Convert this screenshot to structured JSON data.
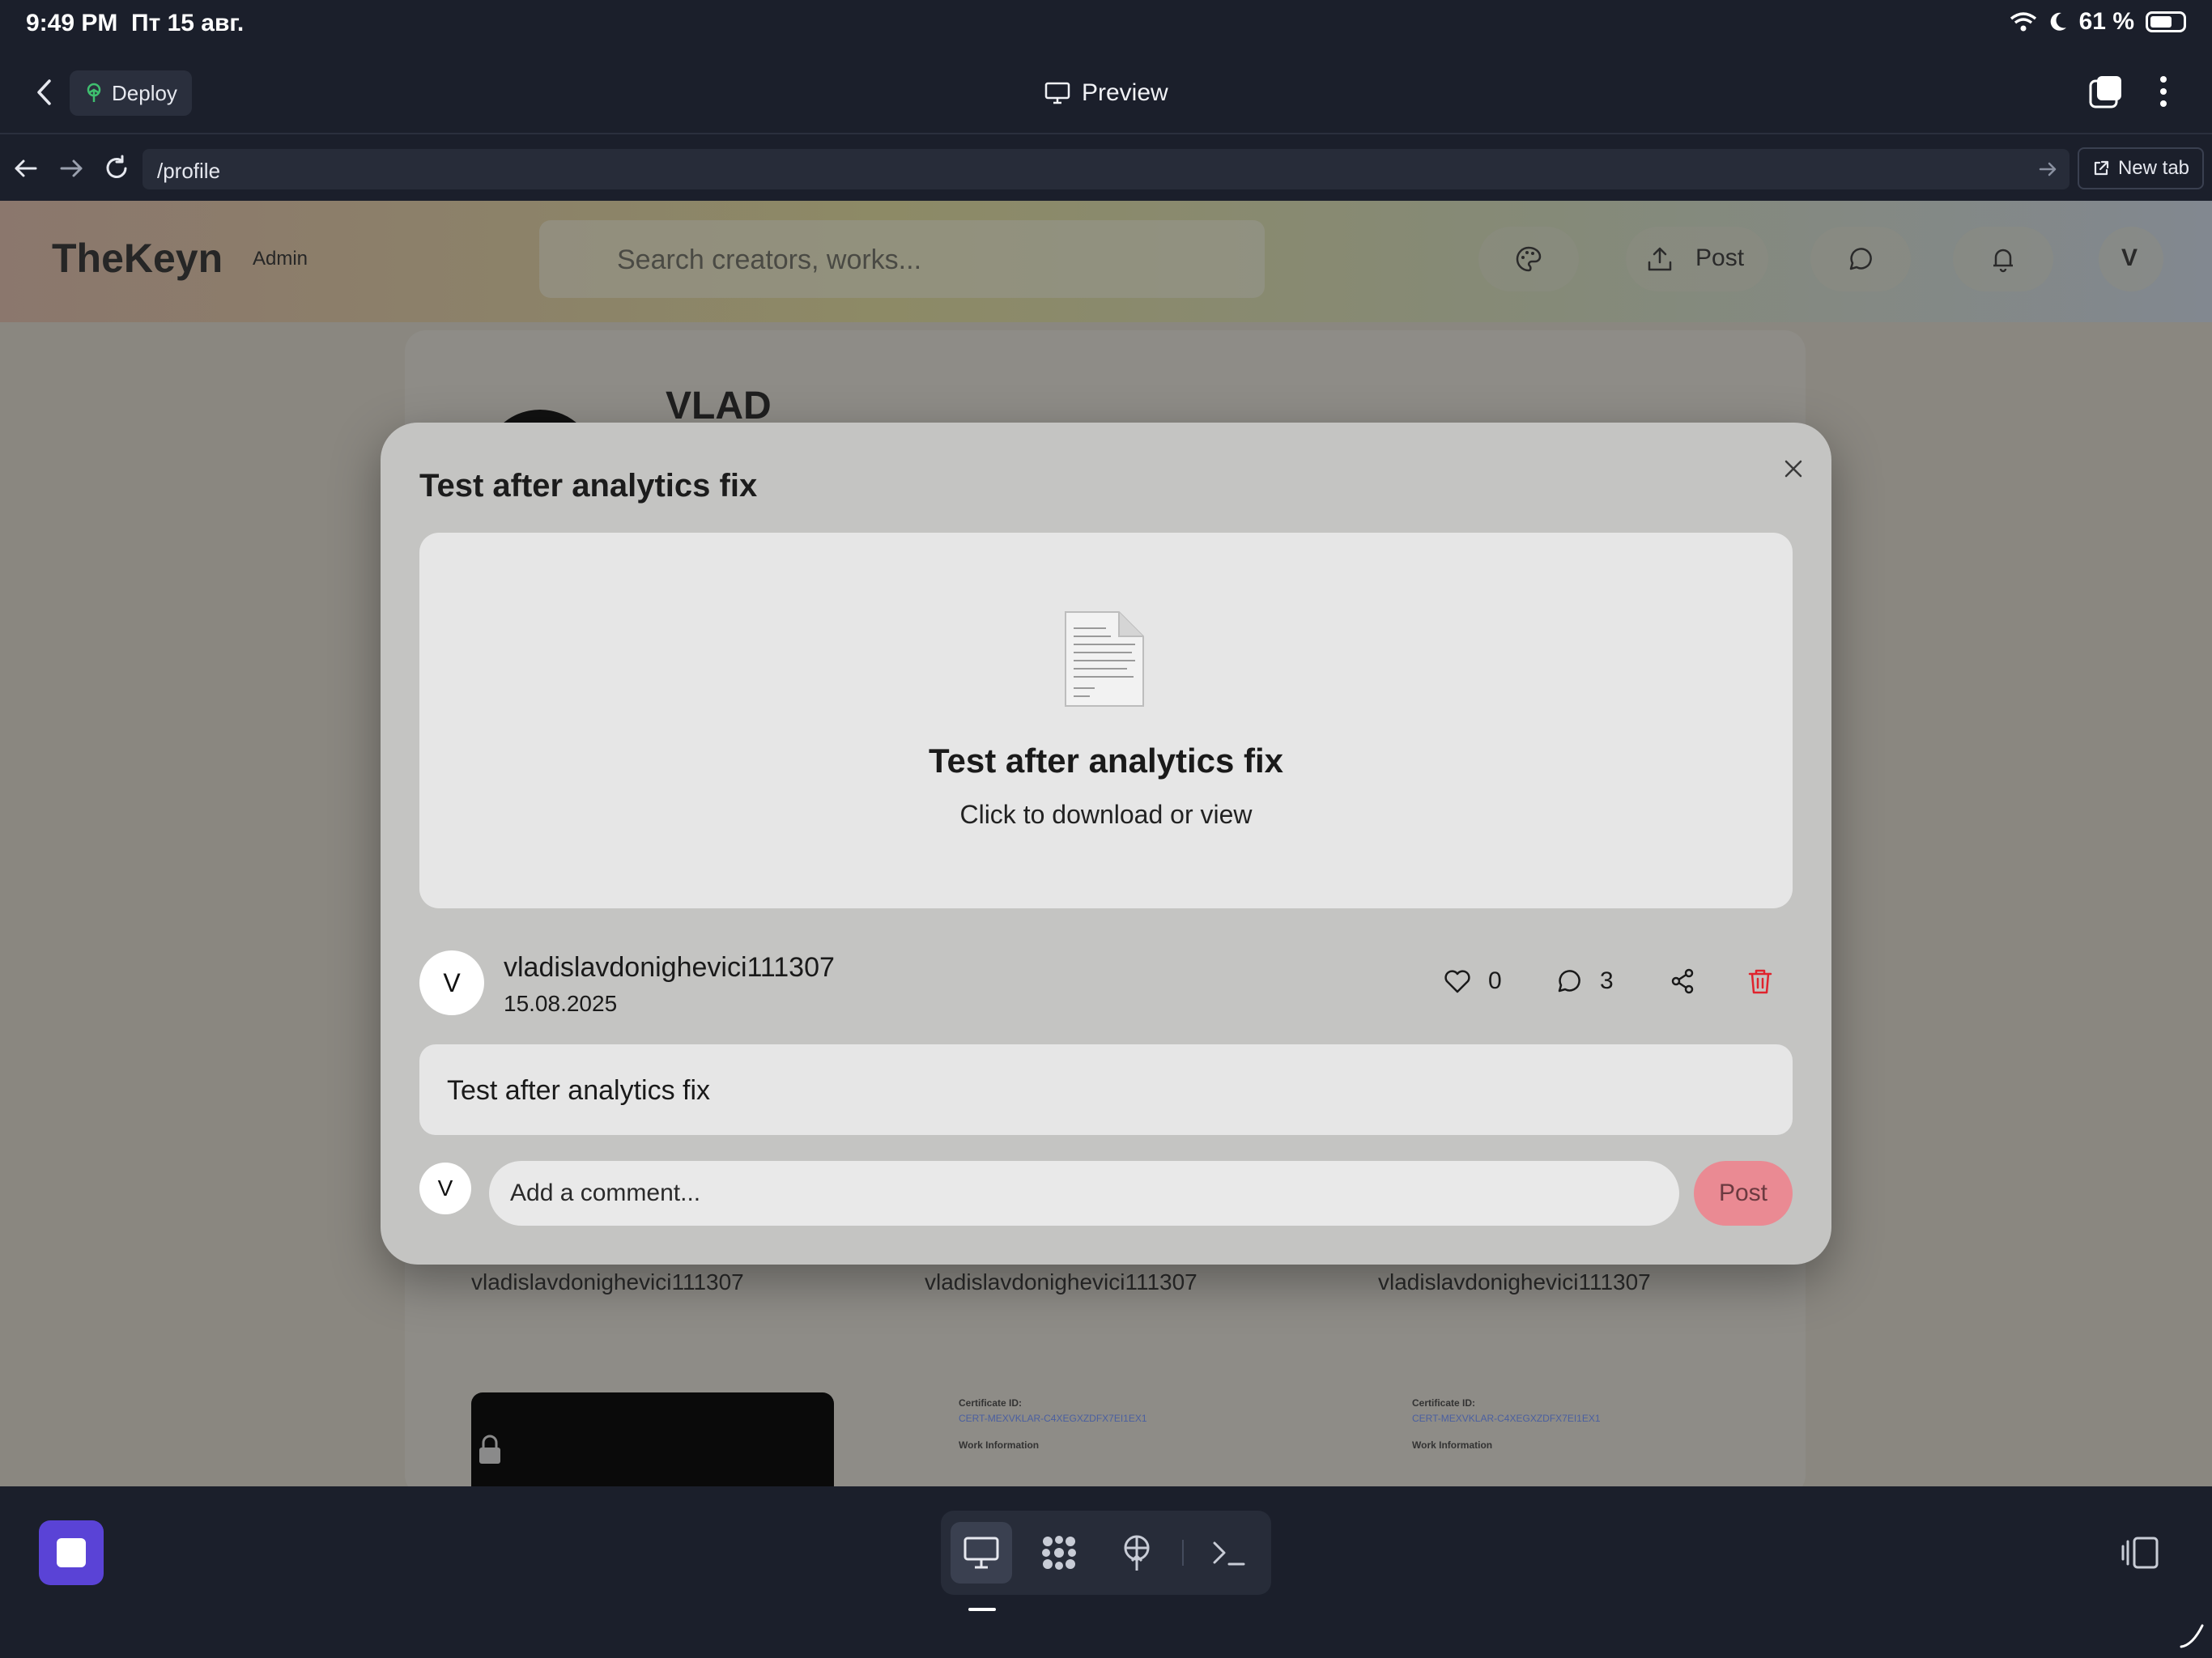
{
  "status_bar": {
    "time": "9:49 PM",
    "date": "Пт 15 авг.",
    "battery": "61 %"
  },
  "app_bar": {
    "deploy_label": "Deploy",
    "preview_label": "Preview"
  },
  "browser": {
    "url": "/profile",
    "new_tab_label": "New tab"
  },
  "page": {
    "brand": "TheKeyn",
    "role_badge": "Admin",
    "search_placeholder": "Search creators, works...",
    "post_label": "Post",
    "user_initial": "V",
    "profile_name": "VLAD",
    "grid_authors": [
      "vladislavdonighevici111307",
      "vladislavdonighevici111307",
      "vladislavdonighevici111307"
    ],
    "doc_thumbnails": [
      {
        "line1": "Certificate ID:",
        "line2": "CERT-MEXVKLAR-C4XEGXZDFX7EI1EX1",
        "line3": "Work Information"
      },
      {
        "line1": "Certificate ID:",
        "line2": "CERT-MEXVKLAR-C4XEGXZDFX7EI1EX1",
        "line3": "Work Information"
      }
    ]
  },
  "modal": {
    "title": "Test after analytics fix",
    "file": {
      "title": "Test after analytics fix",
      "subtitle": "Click to download or view"
    },
    "author": {
      "initial": "V",
      "name": "vladislavdonighevici111307",
      "date": "15.08.2025"
    },
    "stats": {
      "likes": "0",
      "comments": "3"
    },
    "description": "Test after analytics fix",
    "comment": {
      "user_initial": "V",
      "placeholder": "Add a comment...",
      "post_label": "Post"
    }
  },
  "colors": {
    "accent_purple": "#5a43d6",
    "delete_red": "#e0232d",
    "post_pink": "#ea8a93"
  }
}
